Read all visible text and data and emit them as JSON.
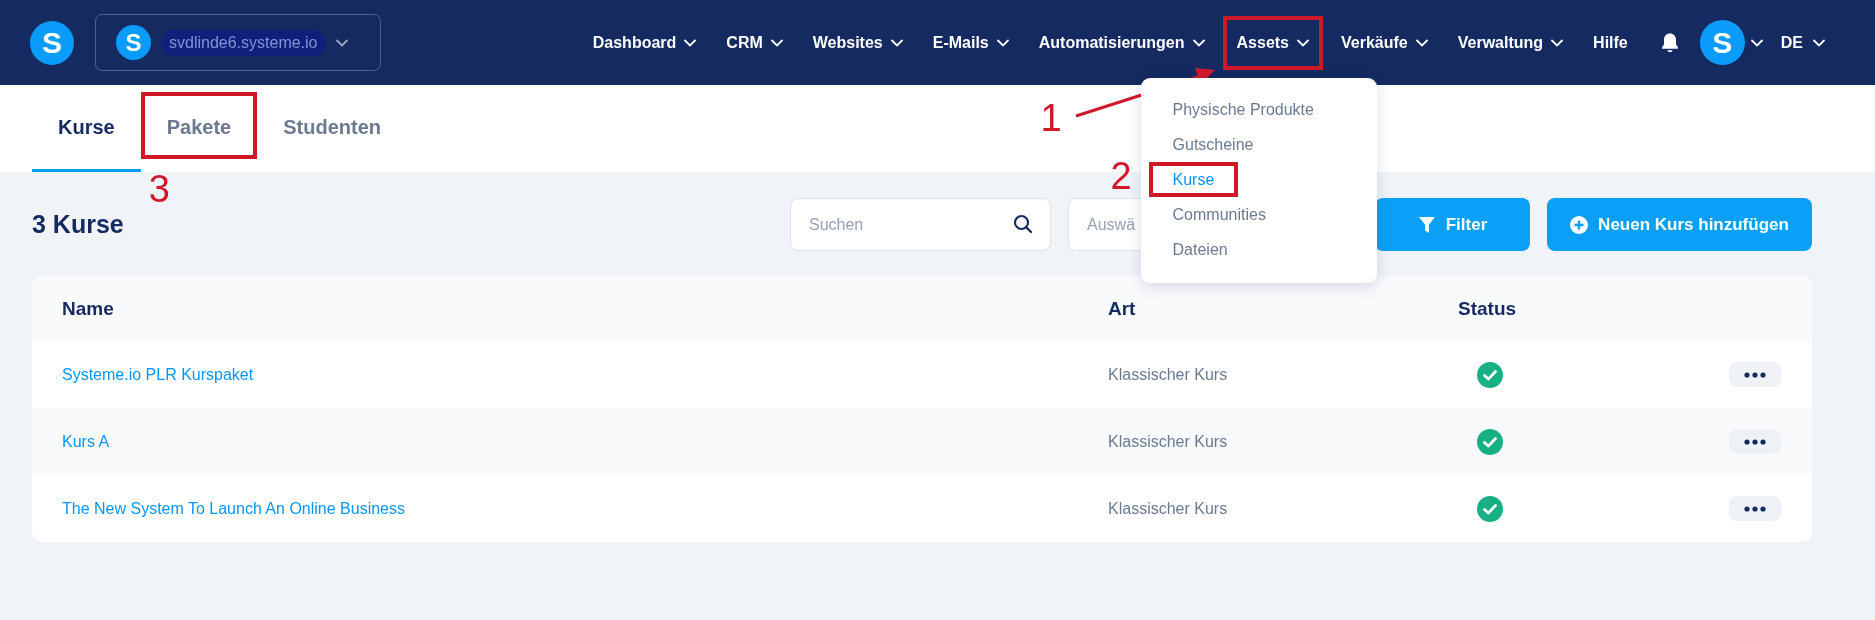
{
  "header": {
    "logo_letter": "S",
    "site_selector": {
      "icon_letter": "S",
      "label": "svdlinde6.systeme.io"
    },
    "nav": [
      {
        "label": "Dashboard",
        "has_menu": true,
        "annotated": false
      },
      {
        "label": "CRM",
        "has_menu": true,
        "annotated": false
      },
      {
        "label": "Websites",
        "has_menu": true,
        "annotated": false
      },
      {
        "label": "E-Mails",
        "has_menu": true,
        "annotated": false
      },
      {
        "label": "Automatisierungen",
        "has_menu": true,
        "annotated": false
      },
      {
        "label": "Assets",
        "has_menu": true,
        "annotated": true,
        "annotation": "1",
        "open_menu": [
          {
            "label": "Physische Produkte",
            "selected": false,
            "annotated": false
          },
          {
            "label": "Gutscheine",
            "selected": false,
            "annotated": false
          },
          {
            "label": "Kurse",
            "selected": true,
            "annotated": true,
            "annotation": "2"
          },
          {
            "label": "Communities",
            "selected": false,
            "annotated": false
          },
          {
            "label": "Dateien",
            "selected": false,
            "annotated": false
          }
        ]
      },
      {
        "label": "Verkäufe",
        "has_menu": true,
        "annotated": false
      },
      {
        "label": "Verwaltung",
        "has_menu": true,
        "annotated": false
      },
      {
        "label": "Hilfe",
        "has_menu": false,
        "annotated": false
      }
    ],
    "avatar_letter": "S",
    "language": "DE"
  },
  "tabs": [
    {
      "label": "Kurse",
      "selected": true,
      "annotated": false
    },
    {
      "label": "Pakete",
      "selected": false,
      "annotated": true,
      "annotation": "3"
    },
    {
      "label": "Studenten",
      "selected": false,
      "annotated": false
    }
  ],
  "toolbar": {
    "title": "3 Kurse",
    "search": {
      "placeholder": "Suchen"
    },
    "select": {
      "placeholder": "Auswä"
    },
    "filter_button": "Filter",
    "add_button": "Neuen Kurs hinzufügen"
  },
  "table": {
    "columns": [
      "Name",
      "Art",
      "Status"
    ],
    "rows": [
      {
        "name": "Systeme.io PLR Kurspaket",
        "type": "Klassischer Kurs",
        "published": true
      },
      {
        "name": "Kurs A",
        "type": "Klassischer Kurs",
        "published": true
      },
      {
        "name": "The New System To Launch An Online Business",
        "type": "Klassischer Kurs",
        "published": true
      }
    ]
  }
}
